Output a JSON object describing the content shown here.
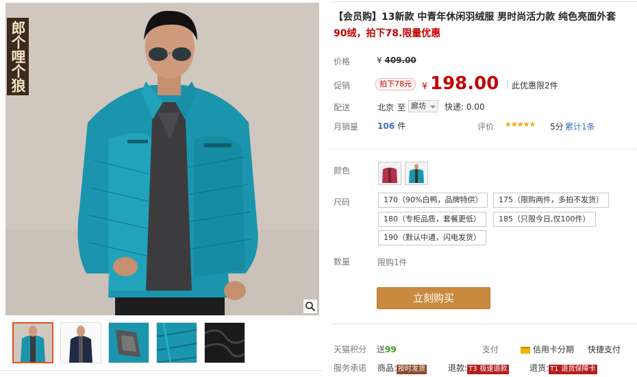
{
  "brand_tag": "郎个哩个狼",
  "product": {
    "title": "【会员购】13新款 中青年休闲羽绒服 男时尚活力款 纯色亮面外套",
    "subtitle": "90绒，拍下78.限量优惠"
  },
  "price": {
    "label": "价格",
    "currency": "¥",
    "original": "409.00"
  },
  "promo": {
    "label": "促销",
    "badge": "拍下78元",
    "currency": "¥",
    "price": "198.00",
    "limit": "此优惠限2件"
  },
  "shipping": {
    "label": "配送",
    "from": "北京",
    "to_word": "至",
    "dest": "廊坊",
    "express": "快递: 0.00"
  },
  "sales": {
    "label": "月销量",
    "count": "106",
    "unit": "件",
    "rating_label": "评价",
    "stars": "★★★★★",
    "score": "5分",
    "total": "累计1条"
  },
  "color": {
    "label": "颜色",
    "options": [
      "red-jacket",
      "teal-jacket"
    ]
  },
  "size": {
    "label": "尺码",
    "options": [
      "170（90%白鸭，品牌特供）",
      "175（限购两件，多拍不发货）",
      "180（专柜品质，套餐更低）",
      "185（只限今日,仅100件）",
      "190（默认中通，闪电发货）"
    ]
  },
  "quantity": {
    "label": "数量",
    "value": "限购1件"
  },
  "buy_button": "立刻购买",
  "points": {
    "label": "天猫积分",
    "send": "送",
    "value": "99",
    "pay_label": "支付",
    "credit": "信用卡分期",
    "quick": "快捷支付"
  },
  "service": {
    "label": "服务承诺",
    "goods": "商品:",
    "goods_tag": "按时发货",
    "refund": "退款:",
    "refund_num": "T3",
    "refund_tag": "极速退款",
    "return": "退货:",
    "return_num": "T1",
    "return_tag": "退货保障卡"
  },
  "colors": {
    "accent_red": "#c40000",
    "buy_button": "#c98a3f",
    "link_blue": "#3c6fbe",
    "jacket_teal": "#1b9ab0"
  }
}
